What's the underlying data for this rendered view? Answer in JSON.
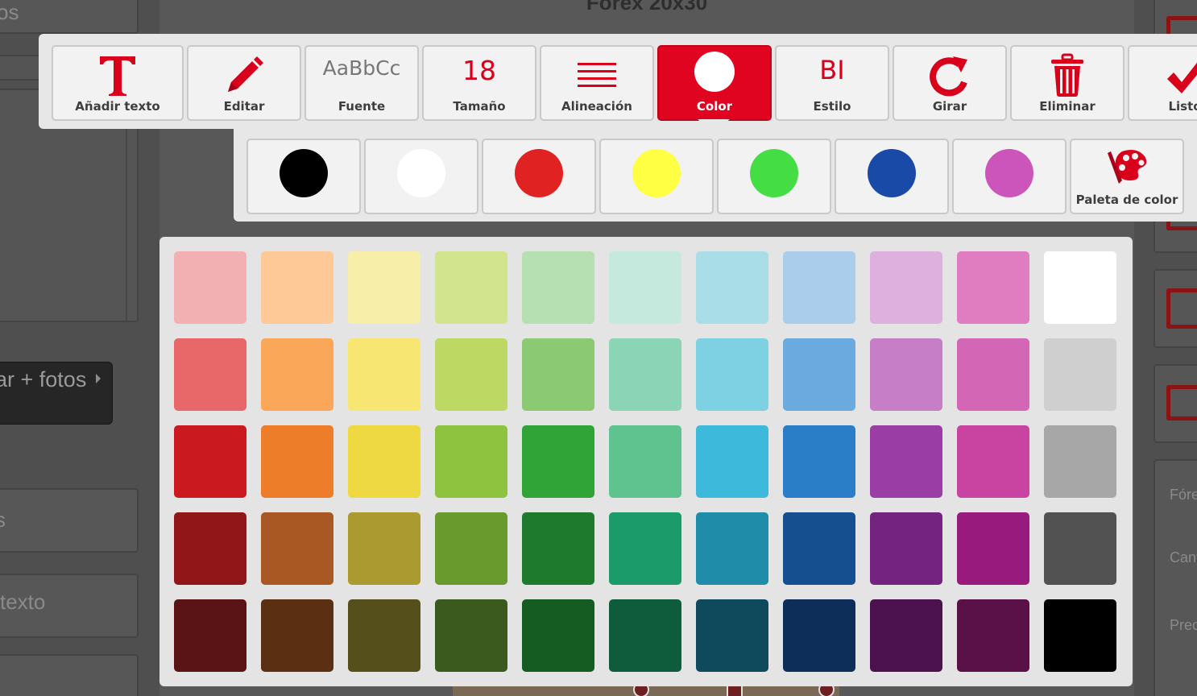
{
  "background": {
    "product_title": "Forex 20x30",
    "left_fragments": [
      "os",
      "ar + fotos",
      "s",
      " texto"
    ],
    "right_labels": [
      "Fóre",
      "Cant",
      "Prec"
    ]
  },
  "toolbar": {
    "items": [
      {
        "name": "add-text-button",
        "label": "Añadir texto",
        "icon": "text-T-icon"
      },
      {
        "name": "edit-button",
        "label": "Editar",
        "icon": "pencil-icon"
      },
      {
        "name": "font-button",
        "label": "Fuente",
        "icon": "font-preview-icon",
        "preview": "AaBbCc"
      },
      {
        "name": "size-button",
        "label": "Tamaño",
        "value": "18"
      },
      {
        "name": "alignment-button",
        "label": "Alineación",
        "icon": "align-lines-icon"
      },
      {
        "name": "color-button",
        "label": "Color",
        "icon": "color-dot-icon",
        "active": true
      },
      {
        "name": "style-button",
        "label": "Estilo",
        "preview": "BI"
      },
      {
        "name": "rotate-button",
        "label": "Girar",
        "icon": "rotate-icon"
      },
      {
        "name": "delete-button",
        "label": "Eliminar",
        "icon": "trash-icon"
      },
      {
        "name": "done-button",
        "label": "Listo",
        "icon": "checkmark-icon"
      }
    ],
    "accent_color": "#e00421"
  },
  "quick_colors": [
    "#000000",
    "#ffffff",
    "#e02222",
    "#ffff44",
    "#44dd44",
    "#1a4aa8",
    "#cc55bb"
  ],
  "palette_button": {
    "label": "Paleta de color",
    "icon": "palette-brush-icon"
  },
  "palette": [
    [
      "#f2b0b3",
      "#fec996",
      "#f7efa9",
      "#d3e48e",
      "#b6e0b1",
      "#c6e9de",
      "#a9dde8",
      "#a9cdea",
      "#deb0dd",
      "#e07cc0",
      "#ffffff"
    ],
    [
      "#e8686a",
      "#fba75a",
      "#f8e672",
      "#bdd964",
      "#8bca73",
      "#8cd4b6",
      "#7dd1e3",
      "#6aaade",
      "#c67ec6",
      "#d466b6",
      "#cfcfcf"
    ],
    [
      "#cb1a1f",
      "#ed7d28",
      "#efd942",
      "#8ec33f",
      "#31a438",
      "#5fc38f",
      "#3dbadb",
      "#2a7ec7",
      "#9a3ea6",
      "#c844a0",
      "#a7a7a7"
    ],
    [
      "#911618",
      "#a95823",
      "#ab9a30",
      "#689a2d",
      "#1e7b2e",
      "#1c9b6a",
      "#1f8caa",
      "#164f8f",
      "#742380",
      "#991a7d",
      "#525252"
    ],
    [
      "#5a1415",
      "#5b3012",
      "#55501b",
      "#3a5a1e",
      "#145c22",
      "#0f5c3d",
      "#0e4a5b",
      "#0c2e58",
      "#4b124f",
      "#5a1148",
      "#000000"
    ]
  ]
}
